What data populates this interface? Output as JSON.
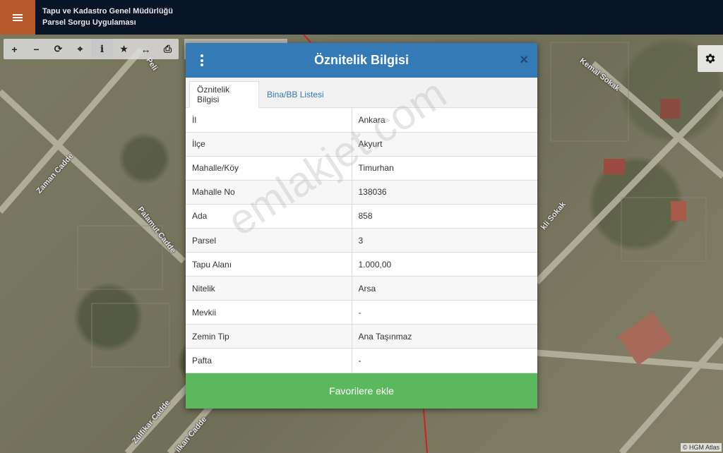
{
  "header": {
    "title_line1": "Tapu ve Kadastro Genel Müdürlüğü",
    "title_line2": "Parsel Sorgu Uygulaması"
  },
  "toolbar": {
    "tools": [
      {
        "name": "zoom-in",
        "glyph": "+"
      },
      {
        "name": "zoom-out",
        "glyph": "−"
      },
      {
        "name": "refresh",
        "glyph": "⟳"
      },
      {
        "name": "locate",
        "glyph": "⌖"
      },
      {
        "name": "info",
        "glyph": "i"
      },
      {
        "name": "favorite",
        "glyph": "★"
      },
      {
        "name": "measure",
        "glyph": "↔"
      },
      {
        "name": "print",
        "glyph": "⎙"
      }
    ]
  },
  "map": {
    "road_labels": [
      "Zaman Cadde",
      "Palamut Cadde",
      "Zülfikar Cadde",
      "Kemal Sokak",
      "kli Sokak",
      "ilkan Cadde",
      "Peli"
    ],
    "attribution": "© HGM Atlas",
    "watermark": "emlakjet.com"
  },
  "modal": {
    "title": "Öznitelik Bilgisi",
    "close_glyph": "×",
    "tabs": [
      "Öznitelik Bilgisi",
      "Bina/BB Listesi"
    ],
    "rows": [
      {
        "key": "İl",
        "value": "Ankara"
      },
      {
        "key": "İlçe",
        "value": "Akyurt"
      },
      {
        "key": "Mahalle/Köy",
        "value": "Timurhan"
      },
      {
        "key": "Mahalle No",
        "value": "138036"
      },
      {
        "key": "Ada",
        "value": "858"
      },
      {
        "key": "Parsel",
        "value": "3"
      },
      {
        "key": "Tapu Alanı",
        "value": "1.000,00"
      },
      {
        "key": "Nitelik",
        "value": "Arsa"
      },
      {
        "key": "Mevkii",
        "value": "-"
      },
      {
        "key": "Zemin Tip",
        "value": "Ana Taşınmaz"
      },
      {
        "key": "Pafta",
        "value": "-"
      }
    ],
    "favorite_label": "Favorilere ekle"
  },
  "colors": {
    "header_bg": "#071526",
    "menu_bg": "#b7592a",
    "modal_header": "#337ab7",
    "favorite_btn": "#5cb85c"
  }
}
